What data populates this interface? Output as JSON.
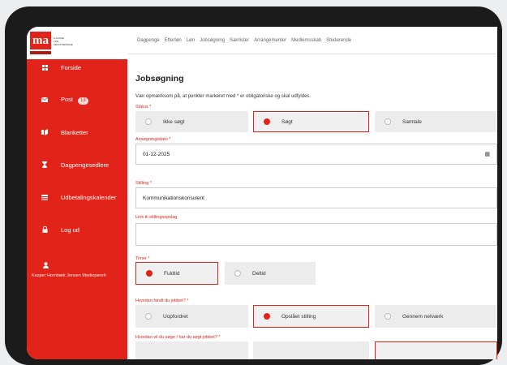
{
  "logo": {
    "mark": "ma",
    "tagline": "A-KASSE FOR SELVSTÆNDIGE"
  },
  "sidebar": {
    "items": [
      {
        "label": "Forside",
        "icon": "grid-icon"
      },
      {
        "label": "Post",
        "badge": "13",
        "icon": "envelope-icon"
      },
      {
        "label": "Blanketter",
        "icon": "forms-icon"
      },
      {
        "label": "Dagpengesedlere",
        "icon": "hourglass-icon"
      },
      {
        "label": "Udbetalingskalender",
        "icon": "calendar-icon"
      },
      {
        "label": "Log ud",
        "icon": "lock-icon"
      }
    ],
    "user": "Kasper Hornbæk Jensen Mediepøreh"
  },
  "topnav": [
    "Dagpenge",
    "Efterløn",
    "Løn",
    "Jobsøgning",
    "Særlister",
    "Arrangementer",
    "Medlemsskab",
    "Studerende"
  ],
  "page": {
    "title": "Jobsøgning",
    "intro": "Vær opmærksom på, at punkter markeret med * er obligatoriske og skal udfyldes.",
    "status": {
      "label": "Status *",
      "options": [
        "Ikke søgt",
        "Søgt",
        "Samtale"
      ],
      "selected": "Søgt"
    },
    "date": {
      "label": "Ansøgningsdato *",
      "value": "01-12-2025"
    },
    "position": {
      "label": "Stilling *",
      "value": "Kommunikationskonsulent"
    },
    "link": {
      "label": "Link til stillingsopslag",
      "value": ""
    },
    "hours": {
      "label": "Timer *",
      "options": [
        "Fuldtid",
        "Deltid"
      ],
      "selected": "Fuldtid"
    },
    "found": {
      "label": "Hvordan fandt du jobbet? *",
      "options": [
        "Uopfordret",
        "Opslået stilling",
        "Gennem netværk"
      ],
      "selected": "Opslået stilling"
    },
    "apply": {
      "label": "Hvordan vil du søge / har du søgt jobbet? *"
    }
  },
  "colors": {
    "brand": "#e2231a",
    "option_bg": "#ececec"
  }
}
